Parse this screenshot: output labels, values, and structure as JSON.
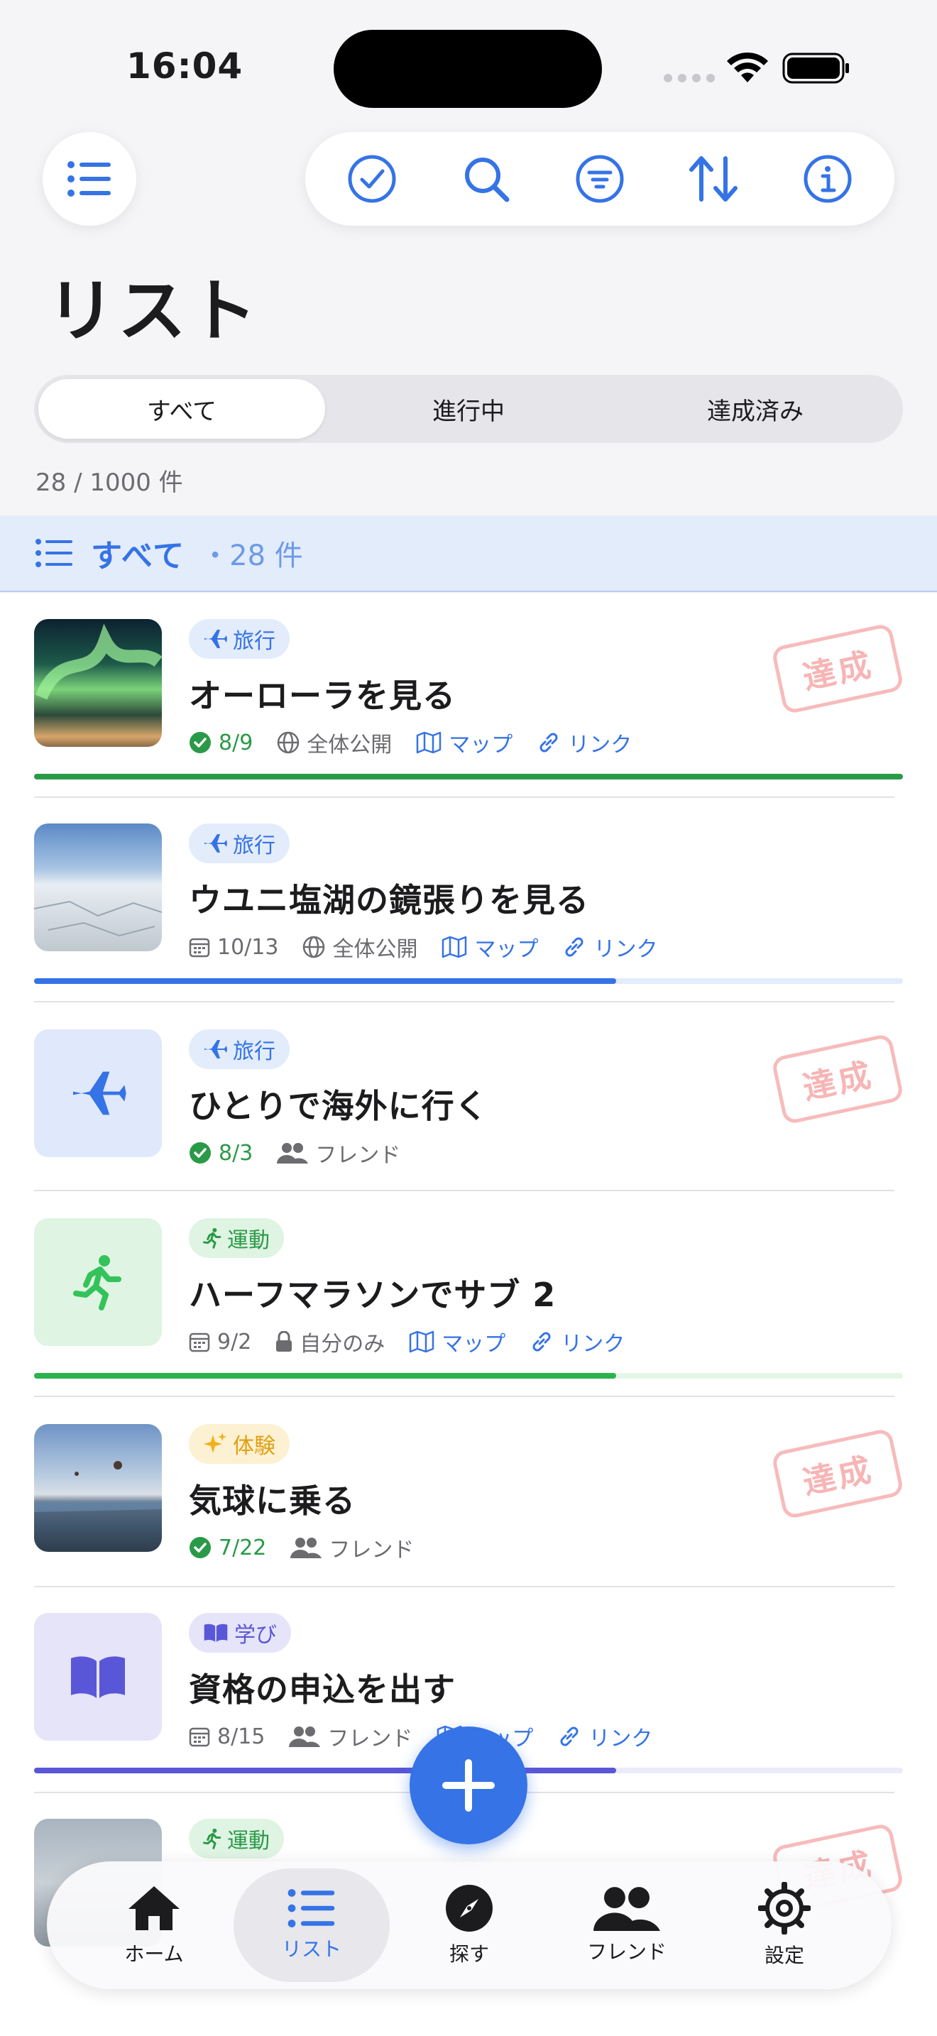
{
  "status": {
    "time": "16:04"
  },
  "title": "リスト",
  "segments": [
    "すべて",
    "進行中",
    "達成済み"
  ],
  "count_text": "28 / 1000 件",
  "section": {
    "title": "すべて",
    "count": "・28 件"
  },
  "stamp_label": "達成",
  "items": [
    {
      "tag": "旅行",
      "title": "オーローラを見る",
      "date": "8/9",
      "visibility": "全体公開",
      "map": "マップ",
      "link": "リンク"
    },
    {
      "tag": "旅行",
      "title": "ウユニ塩湖の鏡張りを見る",
      "date": "10/13",
      "visibility": "全体公開",
      "map": "マップ",
      "link": "リンク"
    },
    {
      "tag": "旅行",
      "title": "ひとりで海外に行く",
      "date": "8/3",
      "visibility": "フレンド"
    },
    {
      "tag": "運動",
      "title": "ハーフマラソンでサブ 2",
      "date": "9/2",
      "visibility": "自分のみ",
      "map": "マップ",
      "link": "リンク"
    },
    {
      "tag": "体験",
      "title": "気球に乗る",
      "date": "7/22",
      "visibility": "フレンド"
    },
    {
      "tag": "学び",
      "title": "資格の申込を出す",
      "date": "8/15",
      "visibility": "フレンド",
      "map": "マップ",
      "link": "リンク"
    },
    {
      "tag": "運動"
    }
  ],
  "tabs": [
    "ホーム",
    "リスト",
    "探す",
    "フレンド",
    "設定"
  ],
  "colors": {
    "accent": "#3573e6",
    "green": "#2a9a48",
    "purple": "#5a56d8",
    "stamp": "#f07878"
  }
}
